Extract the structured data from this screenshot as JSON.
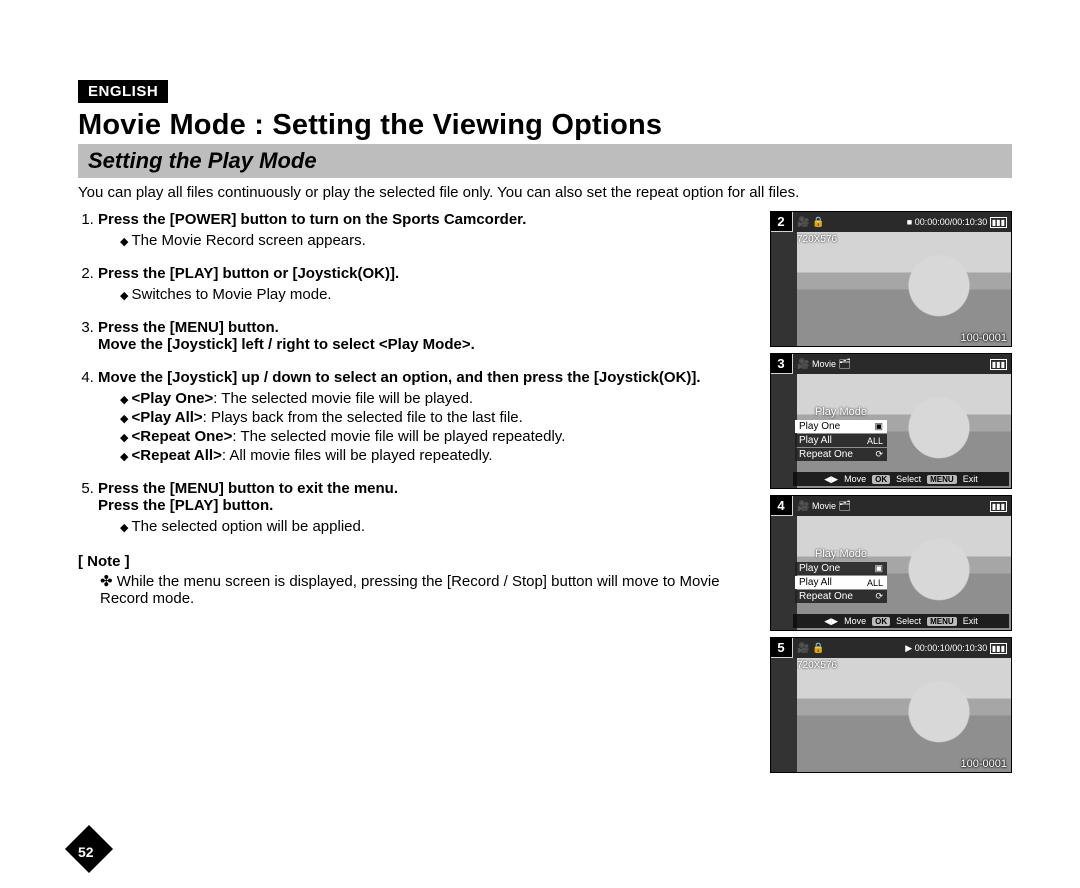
{
  "lang_tag": "ENGLISH",
  "title": "Movie Mode : Setting the Viewing Options",
  "subhead": "Setting the Play Mode",
  "intro": "You can play all files continuously or play the selected file only. You can also set the repeat option for all files.",
  "steps": [
    {
      "title": "Press the [POWER] button to turn on the Sports Camcorder.",
      "bullets": [
        "The Movie Record screen appears."
      ]
    },
    {
      "title": "Press the [PLAY] button or [Joystick(OK)].",
      "bullets": [
        "Switches to Movie Play mode."
      ]
    },
    {
      "title": "Press the [MENU] button.\nMove the [Joystick] left / right to select <Play Mode>.",
      "bullets": []
    },
    {
      "title": "Move the [Joystick] up / down to select an option, and then press the [Joystick(OK)].",
      "bullets": [],
      "options": [
        {
          "term": "<Play One>",
          "desc": ":  The selected movie file will be played."
        },
        {
          "term": "<Play All>",
          "desc": ":  Plays back from the selected file to the last file."
        },
        {
          "term": "<Repeat One>",
          "desc": ":  The selected movie file will be played repeatedly."
        },
        {
          "term": "<Repeat All>",
          "desc": ": All movie files will be played repeatedly."
        }
      ]
    },
    {
      "title": "Press the [MENU] button to exit the menu.\nPress the [PLAY] button.",
      "bullets": [
        "The selected option will be applied."
      ]
    }
  ],
  "note_label": "[ Note ]",
  "notes": [
    "While the menu screen is displayed, pressing the [Record / Stop] button will move to Movie Record mode."
  ],
  "screens": {
    "s2": {
      "num": "2",
      "time": "00:00:00/00:10:30",
      "res": "720X576",
      "clip": "100-0001"
    },
    "s3": {
      "num": "3",
      "mode": "Movie",
      "menu_title": "Play Mode",
      "items": [
        "Play One",
        "Play All",
        "Repeat One"
      ],
      "selected": 0,
      "hints": {
        "move": "Move",
        "select": "Select",
        "exit": "Exit",
        "ok": "OK",
        "menu": "MENU"
      }
    },
    "s4": {
      "num": "4",
      "mode": "Movie",
      "menu_title": "Play Mode",
      "items": [
        "Play One",
        "Play All",
        "Repeat One"
      ],
      "selected": 1,
      "hints": {
        "move": "Move",
        "select": "Select",
        "exit": "Exit",
        "ok": "OK",
        "menu": "MENU"
      }
    },
    "s5": {
      "num": "5",
      "time": "00:00:10/00:10:30",
      "res": "720X576",
      "clip": "100-0001"
    }
  },
  "page_number": "52"
}
